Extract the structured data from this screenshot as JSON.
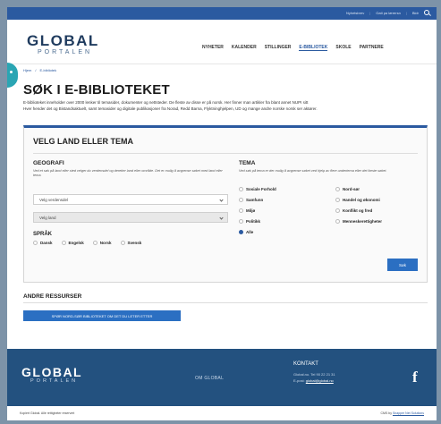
{
  "utility": {
    "link1": "Nyhetsbrev",
    "link2": "Gati pa lærersn",
    "link3": "Bidr"
  },
  "header": {
    "logo_main": "GLOBAL",
    "logo_sub": "PORTALEN"
  },
  "nav": [
    "NYHETER",
    "KALENDER",
    "STILLINGER",
    "E-BIBLIOTEK",
    "SKOLE",
    "PARTNERE"
  ],
  "breadcrumb": {
    "home": "Hjem",
    "current": "E-bibliotek"
  },
  "page_title": "SØK I E-BIBLIOTEKET",
  "intro": {
    "line1": "E-biblioteket inneholder over 2000 lenker til temasider, dokumenter og nettsteder. De fleste av disse er på norsk. Her finner man artikler fra blant annet NUPI sitt",
    "line2": "Hver hender det og Bistandsaktuelt, samt temasider og digitale publikasjoner fra Norad, Redd Barna, Flyktninghjelpen, UD og mange andre norske norsk ser aktører."
  },
  "search_panel": {
    "title": "VELG LAND ELLER TEMA",
    "geografi": {
      "title": "GEOGRAFI",
      "desc": "Ved et søk på land eller sted velger du verdensdel og deretter land eller område. Det er mulig å avgrense søket med land eller tema.",
      "verdensdel": "Velg verdensdel",
      "land": "Velg land"
    },
    "sprak": {
      "title": "SPRÅK",
      "options": [
        "Dansk",
        "Engelsk",
        "Norsk",
        "Svensk"
      ]
    },
    "tema": {
      "title": "TEMA",
      "desc": "Ved søk på tema er der mulig å avgrense søket ved hjelp av flere undertema eller det første søket.",
      "options": [
        "Sosiale Forhold",
        "Nord-sør",
        "Samfunn",
        "Handel og økonomi",
        "Miljø",
        "Konflikt og fred",
        "Politikk",
        "Menneskerettigheter",
        "Alle"
      ],
      "selected": "Alle"
    },
    "search_button": "Søk"
  },
  "resources": {
    "title": "ANDRE RESSURSER",
    "button": "SPØR NORD-SØR BIBLIOTEKET OM DET DU LETER ETTER"
  },
  "footer": {
    "logo_main": "GLOBAL",
    "logo_sub": "PORTALEN",
    "om_global": "OM GLOBAL",
    "contact_title": "KONTAKT",
    "contact_line1": "Global.no. Tel 90 22 21 31",
    "contact_email_label": "E-post:",
    "contact_email": "global@global.no",
    "facebook": "f"
  },
  "bottom": {
    "copyright": "Kopiert Global. Alle rettigheter reservert",
    "credit_prefix": "CMS by",
    "credit_link": "Snapper Net Solutions"
  },
  "colors": {
    "primary": "#2b5aa0",
    "footer": "#23517f",
    "button": "#2b6fc2",
    "accent_tab": "#2aa5b3"
  }
}
